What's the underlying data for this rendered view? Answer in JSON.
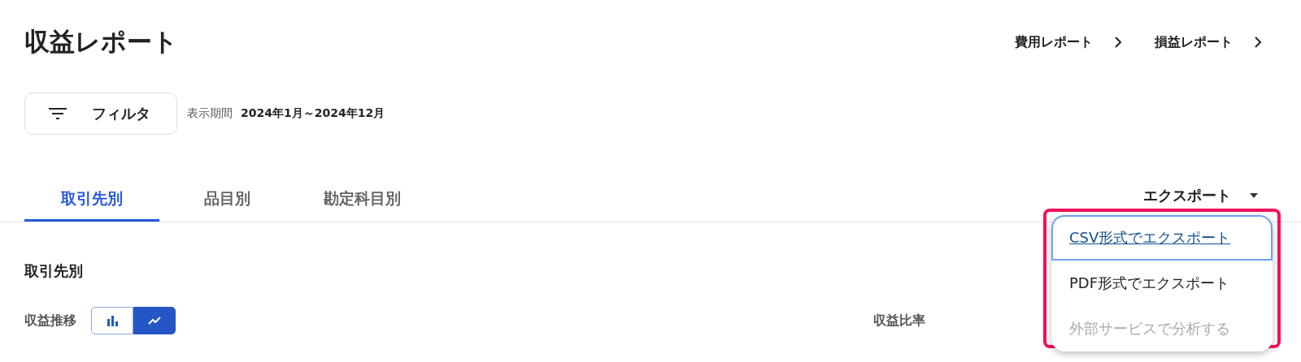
{
  "title": "収益レポート",
  "report_links": [
    {
      "label": "費用レポート"
    },
    {
      "label": "損益レポート"
    }
  ],
  "filter_button": {
    "label": "フィルタ"
  },
  "period": {
    "label": "表示期間",
    "value": "2024年1月～2024年12月"
  },
  "tabs": [
    {
      "label": "取引先別",
      "selected": true
    },
    {
      "label": "品目別",
      "selected": false
    },
    {
      "label": "勘定科目別",
      "selected": false
    }
  ],
  "export": {
    "label": "エクスポート",
    "highlighted": true,
    "menu": [
      {
        "label": "CSV形式でエクスポート",
        "focused": true,
        "disabled": false
      },
      {
        "label": "PDF形式でエクスポート",
        "focused": false,
        "disabled": false
      },
      {
        "label": "外部サービスで分析する",
        "focused": false,
        "disabled": true
      }
    ]
  },
  "section_title": "取引先別",
  "trend": {
    "label": "収益推移",
    "views": [
      {
        "kind": "bar",
        "selected": false
      },
      {
        "kind": "line",
        "selected": true
      }
    ]
  },
  "ratio_label": "収益比率"
}
